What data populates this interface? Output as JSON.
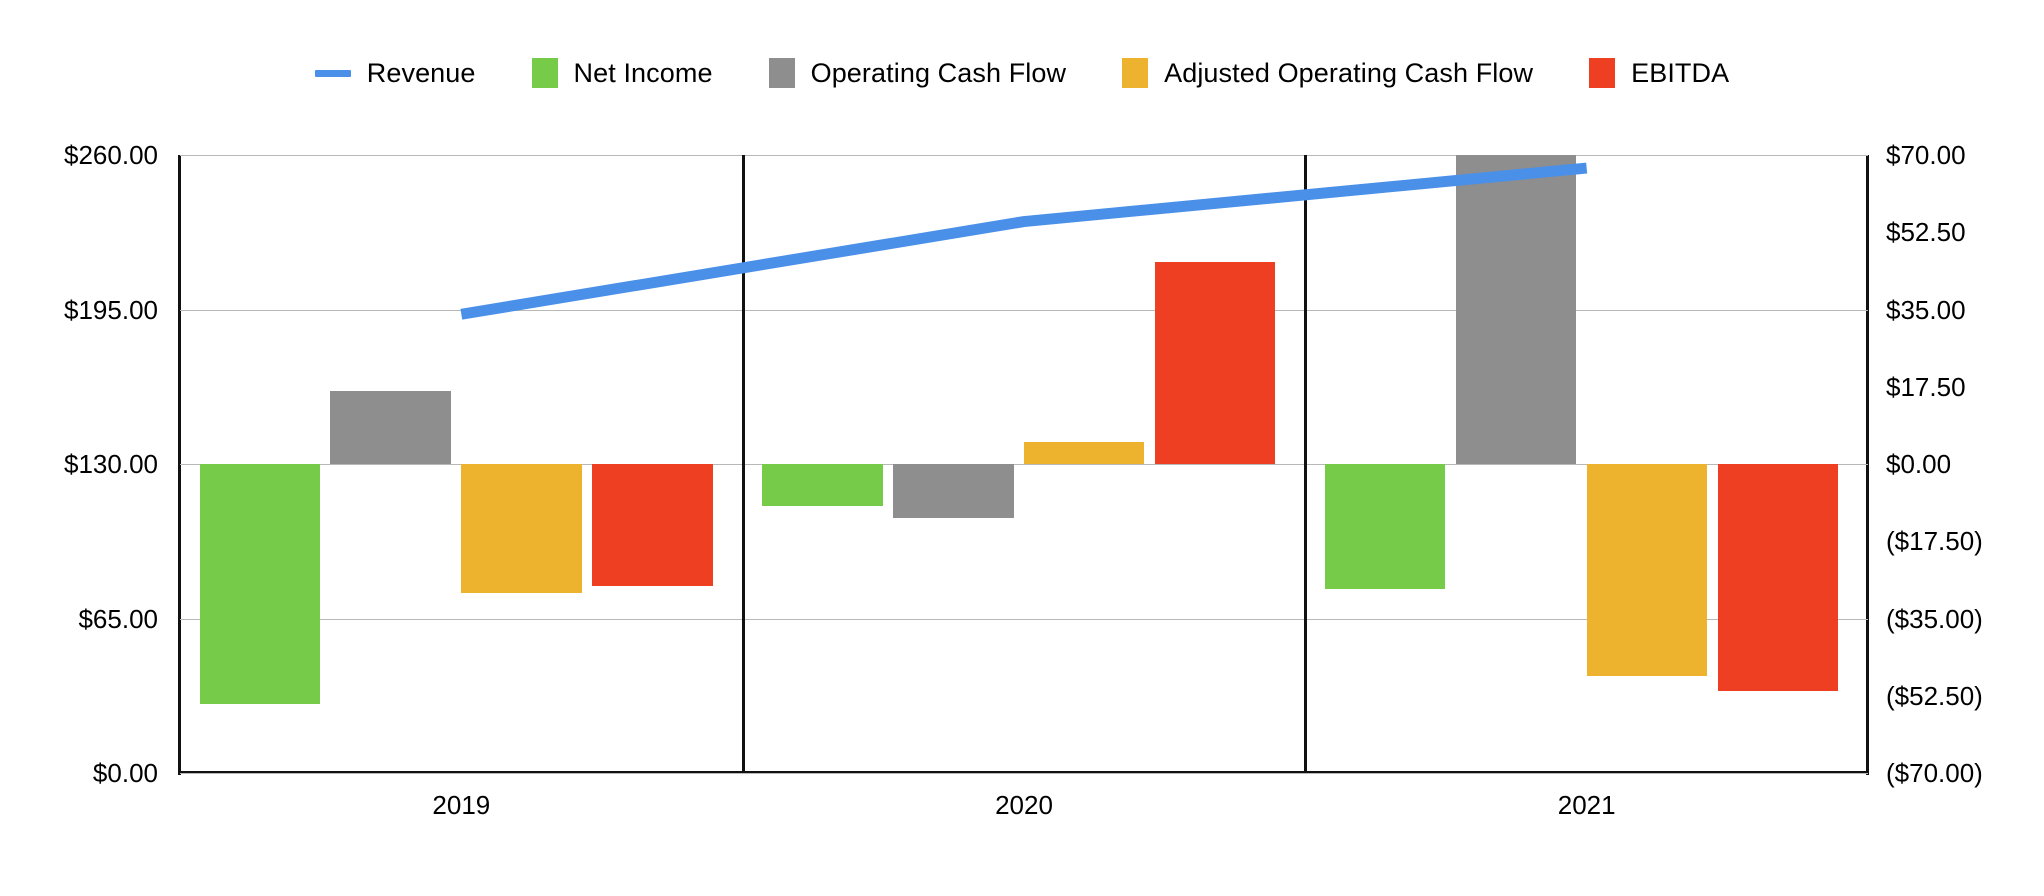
{
  "legend": {
    "items": [
      {
        "label": "Revenue",
        "color": "#4a90e8",
        "marker": "line"
      },
      {
        "label": "Net Income",
        "color": "#76cc48",
        "marker": "square"
      },
      {
        "label": "Operating Cash Flow",
        "color": "#8e8e8e",
        "marker": "square"
      },
      {
        "label": "Adjusted Operating Cash Flow",
        "color": "#eeb32e",
        "marker": "square"
      },
      {
        "label": "EBITDA",
        "color": "#ee3f22",
        "marker": "square"
      }
    ]
  },
  "axes": {
    "left_ticks": [
      "$260.00",
      "$195.00",
      "$130.00",
      "$65.00",
      "$0.00"
    ],
    "right_ticks": [
      "$70.00",
      "$52.50",
      "$35.00",
      "$17.50",
      "$0.00",
      "($17.50)",
      "($35.00)",
      "($52.50)",
      "($70.00)"
    ],
    "categories": [
      "2019",
      "2020",
      "2021"
    ]
  },
  "chart_data": {
    "type": "bar",
    "title": "",
    "xlabel": "",
    "ylabel": "",
    "categories": [
      "2019",
      "2020",
      "2021"
    ],
    "grid": true,
    "legend_position": "top",
    "left_axis": {
      "label": "",
      "ticks": [
        0,
        65,
        130,
        195,
        260
      ],
      "ylim": [
        0,
        260
      ],
      "tick_format": "$0.00"
    },
    "right_axis": {
      "label": "",
      "ticks": [
        -70,
        -52.5,
        -35,
        -17.5,
        0,
        17.5,
        35,
        52.5,
        70
      ],
      "ylim": [
        -70,
        70
      ],
      "tick_format": "$0.00 / ($0.00)"
    },
    "series": [
      {
        "name": "Revenue",
        "type": "line",
        "axis": "left",
        "color": "#4a90e8",
        "values": [
          193.0,
          232.0,
          254.5
        ]
      },
      {
        "name": "Net Income",
        "type": "bar",
        "axis": "right",
        "color": "#76cc48",
        "values": [
          -54.3,
          -9.5,
          -28.4
        ]
      },
      {
        "name": "Operating Cash Flow",
        "type": "bar",
        "axis": "right",
        "color": "#8e8e8e",
        "values": [
          16.6,
          -12.3,
          70.0
        ]
      },
      {
        "name": "Adjusted Operating Cash Flow",
        "type": "bar",
        "axis": "right",
        "color": "#eeb32e",
        "values": [
          -29.3,
          5.0,
          -48.0
        ]
      },
      {
        "name": "EBITDA",
        "type": "bar",
        "axis": "right",
        "color": "#ee3f22",
        "values": [
          -27.7,
          45.7,
          -51.4
        ]
      }
    ]
  },
  "colors": {
    "revenue": "#4a90e8",
    "net_income": "#76cc48",
    "operating_cash_flow": "#8e8e8e",
    "adjusted_operating_cash_flow": "#eeb32e",
    "ebitda": "#ee3f22",
    "gridline": "#b8b8b8",
    "axis": "#111111",
    "background": "#ffffff"
  }
}
